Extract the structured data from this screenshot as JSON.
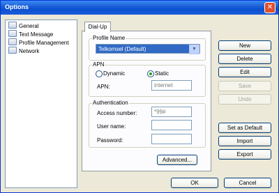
{
  "window": {
    "title": "Options",
    "close_glyph": "✕"
  },
  "tree": {
    "items": [
      "General",
      "Text Message",
      "Profile Management",
      "Network"
    ]
  },
  "tab": {
    "label": "Dial-Up"
  },
  "profile": {
    "group_label": "Profile Name",
    "selected": "Telkomsel (Default)",
    "dropdown_glyph": "▼"
  },
  "apn": {
    "group_label": "APN",
    "dynamic_label": "Dynamic",
    "static_label": "Static",
    "selected": "Static",
    "apn_label": "APN:",
    "apn_value": "internet"
  },
  "auth": {
    "group_label": "Authentication",
    "access_label": "Access number:",
    "access_value": "*99#",
    "user_label": "User name:",
    "user_value": "",
    "password_label": "Password:",
    "password_value": ""
  },
  "buttons": {
    "advanced": "Advanced...",
    "new": "New",
    "delete": "Delete",
    "edit": "Edit",
    "save": "Save",
    "undo": "Undo",
    "set_default": "Set as Default",
    "import": "Import",
    "export": "Export",
    "ok": "OK",
    "cancel": "Cancel"
  }
}
